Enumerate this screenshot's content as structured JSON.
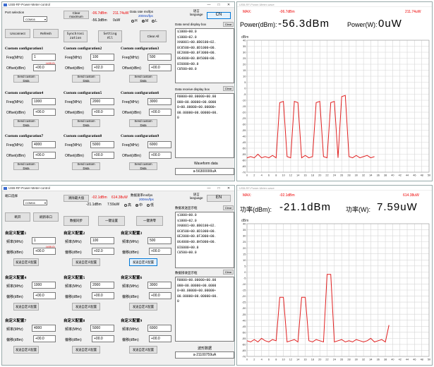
{
  "ctl": {
    "title": "USB-RF-Power-Meter-control",
    "win_min": "—",
    "win_max": "□",
    "win_close": "✕",
    "port_label": "Port selection",
    "port_value": "COM16",
    "clear_max_btn": "Clear\nmaximum",
    "max_dbm": "-06.7dBm",
    "max_uw": "211.74uW",
    "cur_dbm": "-56.3dBm",
    "cur_uw": "0uW",
    "rate_label": "Data rate ms/fps",
    "rate_value": "200ms/fps",
    "opt_h": "H",
    "opt_m": "M",
    "opt_l": "L",
    "lang_label": "语言\nlanguage",
    "lang_btn": "CN",
    "disconnect_btn": "Unconnect",
    "refresh_btn": "Refresh",
    "sync_btn": "Synchroni\nzation",
    "setting_btn": "Setting\nAll",
    "clear_all_btn": "Clear All",
    "send_box_label": "Data send display box",
    "send_box_clear": "Clear",
    "send_text": "$1000+00.0\n$1000+02.0\nXA0001+00.0B0100+02.\n0C0500+00.0D1000+00.\n0E2000+00.0F3000+00.\n0G4000+00.0H5000+00.\n0I6000+00.0\nC0500+00.0",
    "recv_box_label": "Data receive display box",
    "recv_box_clear": "Clear",
    "recv_text": "R0000+00.00000+00.00\n000+00.00000+00.0000\n0+00.00000+00.00000+\n00.00000+00.00000+00.\n0",
    "wave_data_label": "Waveform data",
    "wave_data_value": "a-56300000uA",
    "freq_label": "Freq(MHz)",
    "offset_label": "Offset(dBm)",
    "send_label": "Send custom\nData",
    "configs": [
      {
        "title": "Custom configuration1",
        "freq": "1",
        "offset": "+00.0",
        "note": "(±99.0)"
      },
      {
        "title": "Custom configuration2",
        "freq": "100",
        "offset": "+02.0",
        "note": ""
      },
      {
        "title": "Custom configuration3",
        "freq": "500",
        "offset": "+00.0",
        "note": ""
      },
      {
        "title": "Custom configuration4",
        "freq": "1000",
        "offset": "+00.0",
        "note": ""
      },
      {
        "title": "Custom configuration5",
        "freq": "2000",
        "offset": "+00.0",
        "note": ""
      },
      {
        "title": "Custom configuration6",
        "freq": "3000",
        "offset": "+00.0",
        "note": ""
      },
      {
        "title": "Custom configuration7",
        "freq": "4000",
        "offset": "+00.0",
        "note": ""
      },
      {
        "title": "Custom configuration8",
        "freq": "5000",
        "offset": "+00.0",
        "note": ""
      },
      {
        "title": "Custom configuration9",
        "freq": "6000",
        "offset": "+00.0",
        "note": ""
      }
    ]
  },
  "ctl_cn": {
    "title": "USB-RF-Power-Meter-control",
    "win_min": "—",
    "win_max": "□",
    "win_close": "✕",
    "port_label": "端口选择",
    "port_value": "COM16",
    "clear_max_btn": "清除最大值",
    "max_dbm": "-02.1dBm",
    "max_uw": "614.38uW",
    "cur_dbm": "-21.1dBm",
    "cur_uw": "7.59uW",
    "rate_label": "数据速率ms/fps",
    "rate_value": "200ms/fps",
    "opt_h": "高",
    "opt_m": "中",
    "opt_l": "低",
    "lang_label": "语言\nlanguage",
    "lang_btn": "EN",
    "disconnect_btn": "断开",
    "refresh_btn": "刷新串口",
    "sync_btn": "数据同步",
    "setting_btn": "一键设置",
    "clear_all_btn": "一键清零",
    "send_box_label": "数据发送显示框",
    "send_box_clear": "Clear",
    "send_text": "$1000+00.0\n$1000+02.0\nXA0001+00.0B0100+02.\n0C0500+00.0D1000+00.\n0E2000+00.0F3000+00.\n0G4000+00.0H5000+00.\n0I6000+00.0\nC0500+00.0",
    "recv_box_label": "数据接收显示框",
    "recv_box_clear": "Clear",
    "recv_text": "R0000+00.00000+00.00\n000+00.00000+00.0000\n0+00.00000+00.00000+\n00.00000+00.00000+00.\n0",
    "wave_data_label": "波形数据",
    "wave_data_value": "a-21100759uA",
    "freq_label": "频率(MHz)",
    "offset_label": "偏移(dBm)",
    "send_label": "发送自定义配置",
    "configs": [
      {
        "title": "自定义配置1",
        "freq": "1",
        "offset": "+00.0",
        "note": "(±99.0)"
      },
      {
        "title": "自定义配置2",
        "freq": "100",
        "offset": "+02.0",
        "note": ""
      },
      {
        "title": "自定义配置3",
        "freq": "500",
        "offset": "+00.0",
        "note": ""
      },
      {
        "title": "自定义配置4",
        "freq": "1000",
        "offset": "+00.0",
        "note": ""
      },
      {
        "title": "自定义配置5",
        "freq": "2000",
        "offset": "+00.0",
        "note": ""
      },
      {
        "title": "自定义配置6",
        "freq": "3000",
        "offset": "+00.0",
        "note": ""
      },
      {
        "title": "自定义配置7",
        "freq": "4000",
        "offset": "+00.0",
        "note": ""
      },
      {
        "title": "自定义配置8",
        "freq": "5000",
        "offset": "+00.0",
        "note": ""
      },
      {
        "title": "自定义配置9",
        "freq": "6000",
        "offset": "+00.0",
        "note": ""
      }
    ]
  },
  "wave": {
    "title": "USB-RF-Power-Meter-wave",
    "max_label": "MAX:",
    "max_dbm": "-06.7dBm",
    "max_uw": "211.74uW",
    "power_dbm_label": "Power(dBm):",
    "power_dbm_value": "-56.3dBm",
    "power_w_label": "Power(W):",
    "power_w_value": "0uW"
  },
  "wave_cn": {
    "title": "USB-RF-Power-Meter-wave",
    "max_label": "MAX:",
    "max_dbm": "-02.1dBm",
    "max_uw": "614.38uW",
    "power_dbm_label": "功率(dBm):",
    "power_dbm_value": "-21.1dBm",
    "power_w_label": "功率(W):",
    "power_w_value": "7.59uW"
  },
  "chart_data": [
    {
      "type": "line",
      "ylabel": "dBm",
      "ylim": [
        -70,
        40
      ],
      "xlim": [
        0,
        50
      ],
      "x_ticks": [
        0,
        2,
        4,
        6,
        8,
        10,
        12,
        14,
        16,
        18,
        20,
        22,
        24,
        26,
        28,
        30,
        32,
        34,
        36,
        38,
        40,
        42,
        44,
        46,
        48,
        50
      ],
      "y_ticks": [
        40,
        35,
        30,
        25,
        20,
        15,
        10,
        5,
        0,
        -5,
        -10,
        -15,
        -20,
        -25,
        -30,
        -35,
        -40,
        -45,
        -50,
        -55,
        -60,
        -65,
        -70
      ],
      "grid": true,
      "series": [
        {
          "x": [
            0,
            1,
            2,
            3,
            4,
            5,
            6,
            7,
            8,
            9,
            10,
            11,
            12,
            13,
            14,
            15,
            16,
            17,
            18,
            19,
            20,
            21,
            22,
            23,
            24,
            25,
            26,
            27,
            28,
            29,
            30,
            31,
            32,
            33,
            34,
            35
          ],
          "y": [
            -58,
            -57,
            -58,
            -55,
            -58,
            -57,
            -58,
            -56,
            -58,
            -12,
            -11,
            -57,
            -58,
            -11,
            -12,
            -58,
            -56,
            -58,
            -57,
            -12,
            -11,
            -57,
            -58,
            -12,
            -11,
            -58,
            -7,
            -6,
            -57,
            -58,
            -56,
            -58,
            -57,
            -56,
            -58,
            -57
          ]
        }
      ]
    },
    {
      "type": "line",
      "ylabel": "dBm",
      "ylim": [
        -70,
        40
      ],
      "xlim": [
        0,
        50
      ],
      "x_ticks": [
        0,
        2,
        4,
        6,
        8,
        10,
        12,
        14,
        16,
        18,
        20,
        22,
        24,
        26,
        28,
        30,
        32,
        34,
        36,
        38,
        40,
        42,
        44,
        46,
        48,
        50
      ],
      "y_ticks": [
        40,
        35,
        30,
        25,
        20,
        15,
        10,
        5,
        0,
        -5,
        -10,
        -15,
        -20,
        -25,
        -30,
        -35,
        -40,
        -45,
        -50,
        -55,
        -60,
        -65,
        -70
      ],
      "grid": true,
      "series": [
        {
          "x": [
            0,
            1,
            2,
            3,
            4,
            5,
            6,
            7,
            8,
            9,
            10,
            11,
            12,
            13,
            14,
            15,
            16,
            17,
            18,
            19,
            20,
            21,
            22,
            23,
            24,
            25,
            26,
            27,
            28,
            29,
            30,
            31,
            32,
            33,
            34,
            35,
            36,
            37,
            38,
            39
          ],
          "y": [
            -57,
            -58,
            -56,
            -58,
            -55,
            -57,
            -58,
            -56,
            -57,
            -21,
            -21,
            -58,
            -57,
            -56,
            -58,
            -21,
            -21,
            -57,
            -58,
            -56,
            -57,
            -58,
            -2,
            -2,
            -58,
            -57,
            -56,
            -58,
            -57,
            -58,
            -56,
            -57,
            -58,
            -57,
            -55,
            -58,
            -57,
            -56,
            -58,
            -44
          ]
        }
      ]
    }
  ]
}
